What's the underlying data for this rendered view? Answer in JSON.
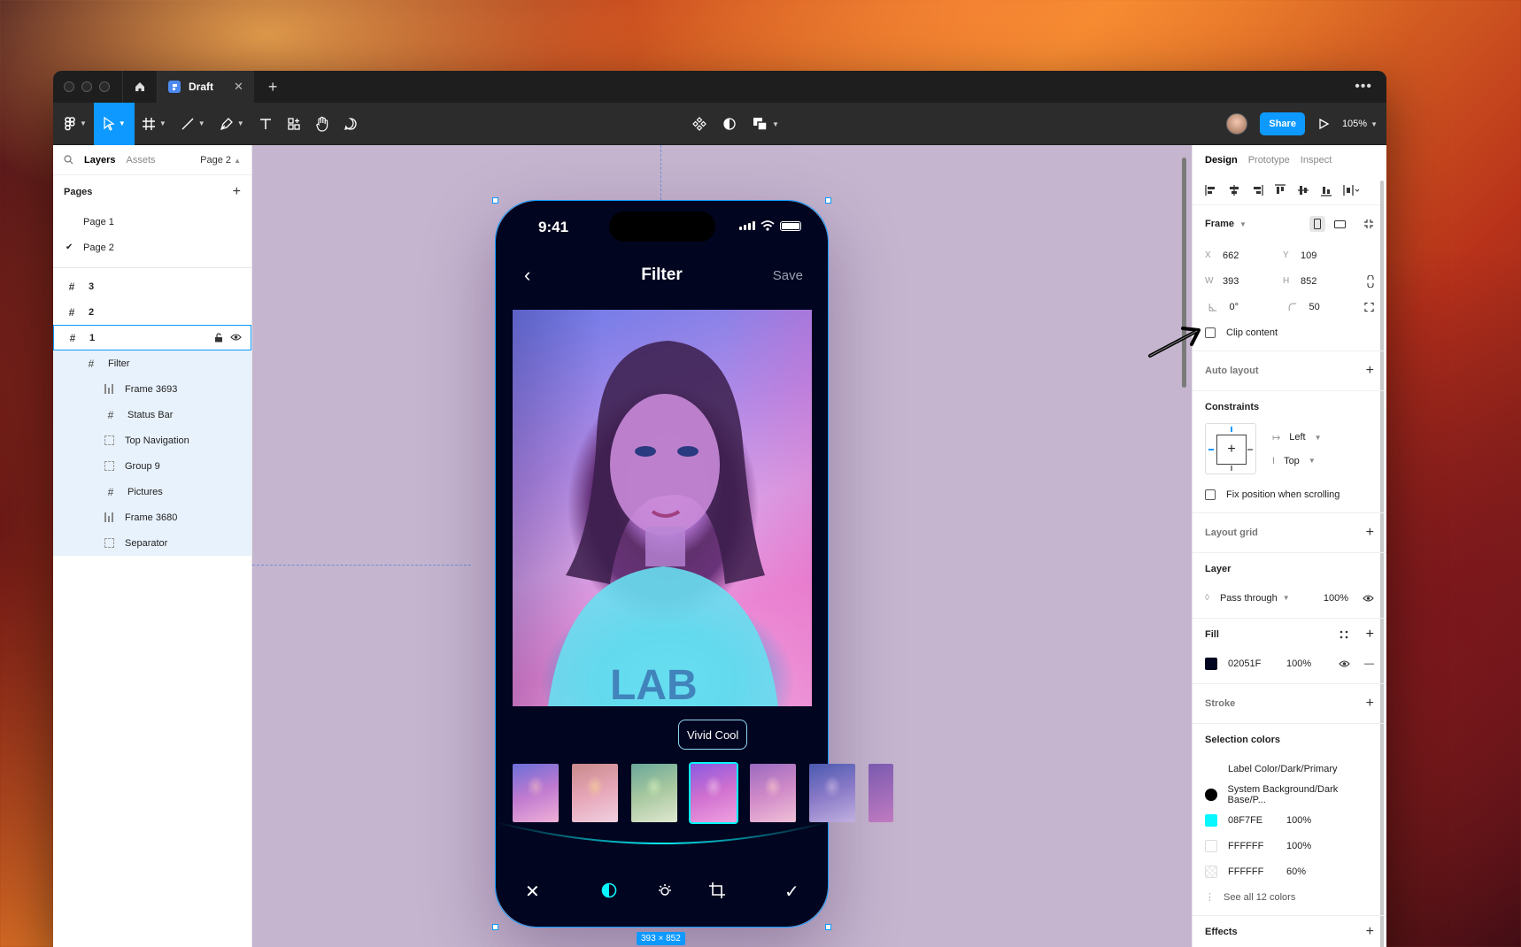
{
  "window": {
    "tab_title": "Draft",
    "zoom": "105%",
    "share_label": "Share"
  },
  "left_panel": {
    "tabs": [
      "Layers",
      "Assets"
    ],
    "current_page": "Page 2",
    "pages_heading": "Pages",
    "pages": [
      "Page 1",
      "Page 2"
    ],
    "frames": [
      "3",
      "2",
      "1"
    ],
    "filter_frame": "Filter",
    "children": [
      "Frame 3693",
      "Status Bar",
      "Top Navigation",
      "Group 9",
      "Pictures",
      "Frame 3680",
      "Separator"
    ]
  },
  "phone": {
    "time": "9:41",
    "title": "Filter",
    "save": "Save",
    "filter_name": "Vivid Cool",
    "size_label": "393 × 852"
  },
  "right_panel": {
    "tabs": [
      "Design",
      "Prototype",
      "Inspect"
    ],
    "frame_label": "Frame",
    "x": "662",
    "y": "109",
    "w": "393",
    "h": "852",
    "rotation": "0°",
    "radius": "50",
    "clip_content": "Clip content",
    "auto_layout": "Auto layout",
    "constraints": "Constraints",
    "constraint_h": "Left",
    "constraint_v": "Top",
    "fix_position": "Fix position when scrolling",
    "layout_grid": "Layout grid",
    "layer": "Layer",
    "blend_mode": "Pass through",
    "layer_opacity": "100%",
    "fill": "Fill",
    "fill_hex": "02051F",
    "fill_opacity": "100%",
    "stroke": "Stroke",
    "selection_colors": "Selection colors",
    "colors": [
      {
        "name": "Label Color/Dark/Primary",
        "opacity": ""
      },
      {
        "name": "System Background/Dark Base/P...",
        "opacity": ""
      },
      {
        "name": "08F7FE",
        "opacity": "100%"
      },
      {
        "name": "FFFFFF",
        "opacity": "100%"
      },
      {
        "name": "FFFFFF",
        "opacity": "60%"
      }
    ],
    "see_all": "See all 12 colors",
    "effects": "Effects"
  },
  "colors": {
    "accent": "#0d99ff",
    "fill": "#02051F",
    "cyan": "#08F7FE",
    "canvas": "#c5b5cf"
  }
}
